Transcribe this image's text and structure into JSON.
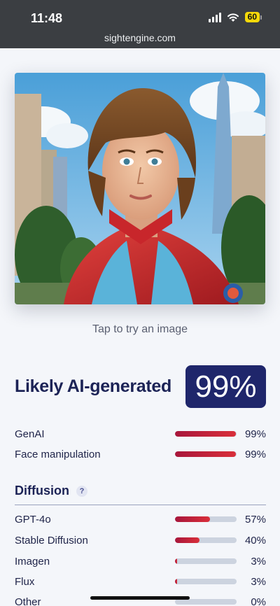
{
  "status_bar": {
    "time": "11:48",
    "battery": "60",
    "battery_color": "#f5d90a"
  },
  "browser": {
    "url": "sightengine.com"
  },
  "image_card": {
    "hint": "Tap to try an image"
  },
  "result": {
    "verdict": "Likely AI-generated",
    "score": "99%",
    "badge_color": "#1f266b"
  },
  "summary": [
    {
      "label": "GenAI",
      "percent": "99%",
      "value": 0.99
    },
    {
      "label": "Face manipulation",
      "percent": "99%",
      "value": 0.99
    }
  ],
  "diffusion": {
    "title": "Diffusion",
    "help": "?",
    "items": [
      {
        "label": "GPT-4o",
        "percent": "57%",
        "value": 0.57
      },
      {
        "label": "Stable Diffusion",
        "percent": "40%",
        "value": 0.4
      },
      {
        "label": "Imagen",
        "percent": "3%",
        "value": 0.03
      },
      {
        "label": "Flux",
        "percent": "3%",
        "value": 0.03
      },
      {
        "label": "Other",
        "percent": "0%",
        "value": 0.0
      }
    ]
  },
  "colors": {
    "bar_fill": "#c8233a",
    "bar_track": "#ccd3df",
    "heading": "#1c2356"
  }
}
